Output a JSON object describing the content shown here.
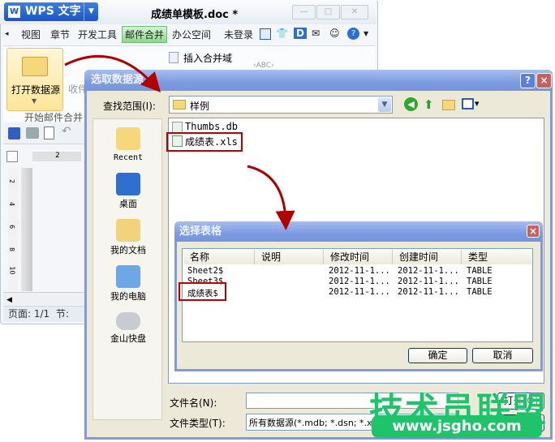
{
  "app": {
    "logo": "WPS 文字",
    "doc_title": "成绩单模板.doc *"
  },
  "tabs": [
    "视图",
    "章节",
    "开发工具",
    "邮件合并",
    "办公空间",
    "未登录"
  ],
  "ribbon": {
    "open_datasource": "打开数据源",
    "recipients": "收件",
    "insert_field": "插入合并域",
    "group_label": "开始邮件合并",
    "abc": "‹ABC›"
  },
  "ruler": {
    "h": "2",
    "v": [
      "2",
      "4",
      "6",
      "8",
      "10"
    ]
  },
  "status": {
    "page": "页面: 1/1",
    "section": "节:"
  },
  "dialog": {
    "title": "选取数据源",
    "look_in_label": "查找范围(I):",
    "look_in_value": "样例",
    "places": [
      "Recent",
      "桌面",
      "我的文档",
      "我的电脑",
      "金山快盘"
    ],
    "files": [
      "Thumbs.db",
      "成绩表.xls"
    ],
    "filename_label": "文件名(N):",
    "filename_value": "",
    "filetype_label": "文件类型(T):",
    "filetype_value": "所有数据源(*.mdb; *.dsn; *.xls; *.xlsx;...",
    "open_button": "打开(O)",
    "cancel_button": "取消",
    "help": "?",
    "close": "×"
  },
  "table_dialog": {
    "title": "选择表格",
    "columns": [
      "名称",
      "说明",
      "修改时间",
      "创建时间",
      "类型"
    ],
    "rows": [
      [
        "Sheet2$",
        "",
        "2012-11-1...",
        "2012-11-1...",
        "TABLE"
      ],
      [
        "Sheet3$",
        "",
        "2012-11-1...",
        "2012-11-1...",
        "TABLE"
      ],
      [
        "成绩表$",
        "",
        "2012-11-1...",
        "2012-11-1...",
        "TABLE"
      ]
    ],
    "ok": "确定",
    "cancel": "取消",
    "close": "×"
  },
  "watermark": {
    "text": "技术员联盟",
    "url": "www.jsgho.com"
  },
  "colors": {
    "highlight": "#c00000",
    "title_bar": "#7d9be0",
    "dialog_bg": "#ece9d8",
    "watermark": "#1fc46a"
  }
}
